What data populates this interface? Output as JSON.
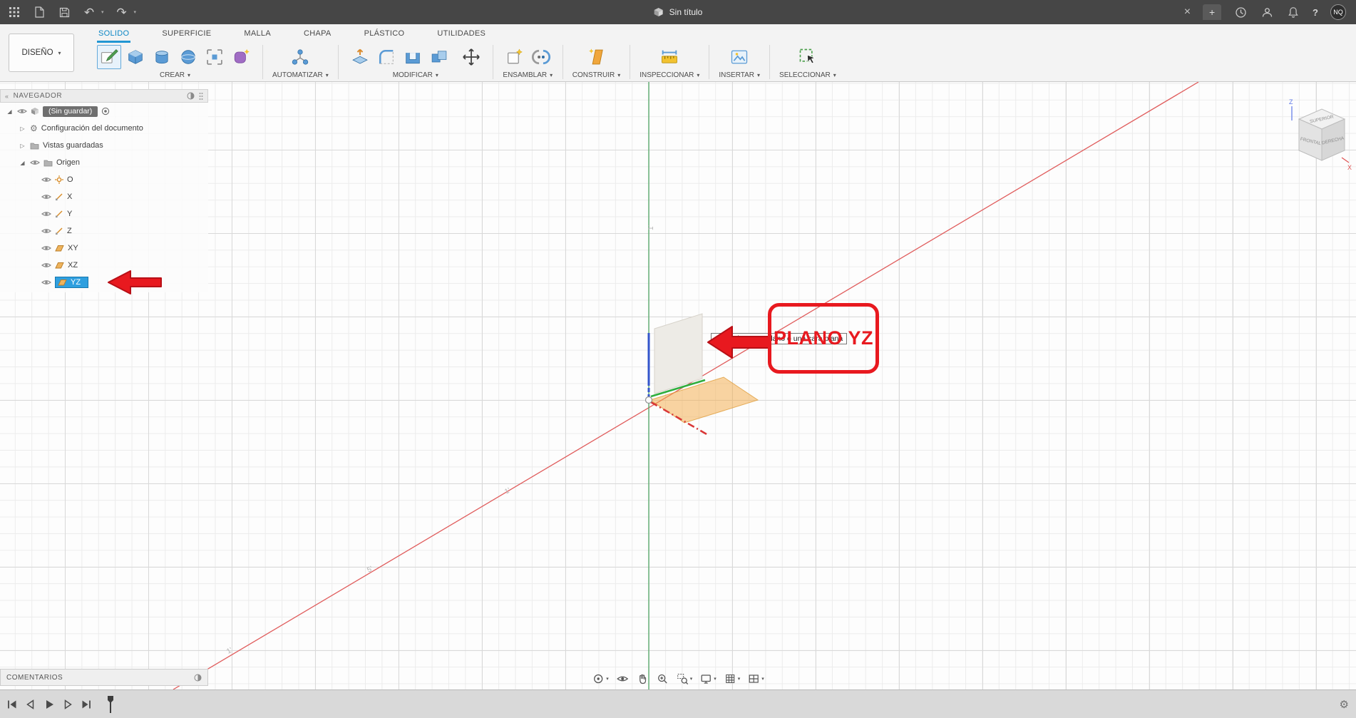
{
  "titlebar": {
    "title": "Sin título",
    "avatar_initials": "NQ"
  },
  "ribbon": {
    "workspace_label": "DISEÑO",
    "tabs": [
      {
        "label": "SOLIDO",
        "active": true
      },
      {
        "label": "SUPERFICIE",
        "active": false
      },
      {
        "label": "MALLA",
        "active": false
      },
      {
        "label": "CHAPA",
        "active": false
      },
      {
        "label": "PLÁSTICO",
        "active": false
      },
      {
        "label": "UTILIDADES",
        "active": false
      }
    ],
    "groups": [
      {
        "label": "CREAR"
      },
      {
        "label": "AUTOMATIZAR"
      },
      {
        "label": "MODIFICAR"
      },
      {
        "label": "ENSAMBLAR"
      },
      {
        "label": "CONSTRUIR"
      },
      {
        "label": "INSPECCIONAR"
      },
      {
        "label": "INSERTAR"
      },
      {
        "label": "SELECCIONAR"
      }
    ]
  },
  "browser": {
    "header": "NAVEGADOR",
    "document": {
      "name": "(Sin guardar)"
    },
    "rows": [
      {
        "label": "Configuración del documento"
      },
      {
        "label": "Vistas guardadas"
      },
      {
        "label": "Origen"
      }
    ],
    "origin_children": [
      {
        "label": "O",
        "selected": false
      },
      {
        "label": "X",
        "selected": false
      },
      {
        "label": "Y",
        "selected": false
      },
      {
        "label": "Z",
        "selected": false
      },
      {
        "label": "XY",
        "selected": false
      },
      {
        "label": "XZ",
        "selected": false
      },
      {
        "label": "YZ",
        "selected": true
      }
    ]
  },
  "viewport": {
    "tooltip": "Seleccionar un plano o una cara plana",
    "annotation_label": "PLANO YZ",
    "axis_tick_labels": [
      "1'",
      "1'",
      "5'",
      "1'"
    ],
    "viewcube": {
      "top_face": "SUPERIOR",
      "left_face": "FRONTAL",
      "right_face": "DERECHA",
      "axis_x": "X",
      "axis_z": "Z"
    }
  },
  "comments_panel": {
    "header": "COMENTARIOS"
  },
  "icons": {
    "caret": "▾",
    "undo": "↶",
    "redo": "↷",
    "close": "×",
    "add_tab": "+",
    "help": "?",
    "gear": "⚙",
    "collapse": "«",
    "expander_open": "◢",
    "expander_closed": "▷"
  },
  "colors": {
    "annotation_red": "#e8191f",
    "selection_blue": "#2f9fdf",
    "axis_x_red": "#e05c5c",
    "axis_y_green": "#55a868",
    "axis_z_blue": "#3355cc",
    "plane_orange": "#f3aa45",
    "active_tab_blue": "#0d87c5"
  }
}
